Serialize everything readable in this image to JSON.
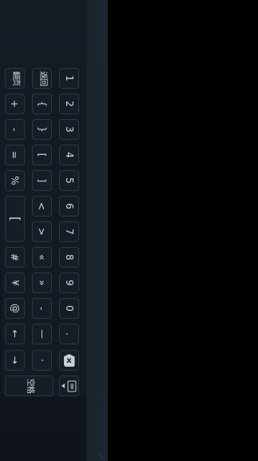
{
  "keyboard": {
    "col_digits": {
      "k1": "1",
      "k2": "2",
      "k3": "3",
      "k4": "4",
      "k5": "5",
      "k6": "6",
      "k7": "7",
      "k8": "8",
      "k9": "9",
      "k0": "0",
      "dot": "."
    },
    "col_symbols_b": {
      "back": "返回",
      "brace_open": "{",
      "brace_close": "}",
      "bracket_open": "[",
      "bracket_close": "]",
      "lt": "<",
      "gt": ">",
      "quote_open": "«",
      "quote_close": "»",
      "dash": "-",
      "emdash": "—",
      "middot": "·"
    },
    "col_symbols_a": {
      "flip": "翻页",
      "plus": "+",
      "minus": "-",
      "equals": "=",
      "percent": "%",
      "bracket_big": "[",
      "hash": "#",
      "yen": "¥",
      "at": "@",
      "up": "↑",
      "down": "↓"
    },
    "space_label": "空格",
    "delete_icon": "x",
    "keyboard_icon": "⌨"
  },
  "corner": {
    "mark": "\\"
  }
}
